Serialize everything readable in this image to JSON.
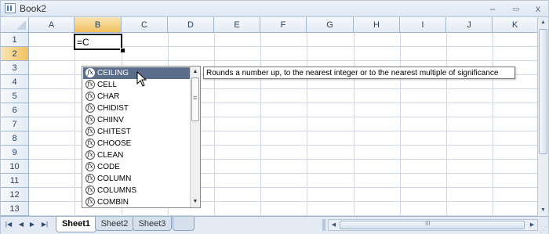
{
  "window": {
    "title": "Book2",
    "app_icon": "excel-workbook-icon",
    "minimize_glyph": "–",
    "restore_glyph": "▭",
    "close_glyph": "x"
  },
  "grid": {
    "columns": [
      "A",
      "B",
      "C",
      "D",
      "E",
      "F",
      "G",
      "H",
      "I",
      "J",
      "K"
    ],
    "rows": [
      "1",
      "2",
      "3",
      "4",
      "5",
      "6",
      "7",
      "8",
      "9",
      "10",
      "11",
      "12",
      "13"
    ],
    "selected_column": "B",
    "selected_row": "2",
    "active_cell": {
      "ref": "B2",
      "value": "=C"
    },
    "gridline_color": "#d0d7e5",
    "header_color": "#e4ebf4"
  },
  "autocomplete": {
    "items": [
      "CEILING",
      "CELL",
      "CHAR",
      "CHIDIST",
      "CHIINV",
      "CHITEST",
      "CHOOSE",
      "CLEAN",
      "CODE",
      "COLUMN",
      "COLUMNS",
      "COMBIN"
    ],
    "selected": "CEILING",
    "item_icon": "function-fx-icon",
    "scroll_up_glyph": "▲",
    "scroll_down_glyph": "▼",
    "highlight_color": "#5a6d8a"
  },
  "tooltip": {
    "text": "Rounds a number up, to the nearest integer or to the nearest multiple of significance"
  },
  "scrollbars": {
    "up_glyph": "▲",
    "down_glyph": "▼",
    "left_glyph": "◀",
    "right_glyph": "▶",
    "grip_glyph": "III"
  },
  "sheet_tabs": {
    "nav": [
      "|◀",
      "◀",
      "▶",
      "▶|"
    ],
    "tabs": [
      "Sheet1",
      "Sheet2",
      "Sheet3"
    ],
    "active": "Sheet1",
    "new_sheet_icon": "insert-worksheet-icon"
  }
}
